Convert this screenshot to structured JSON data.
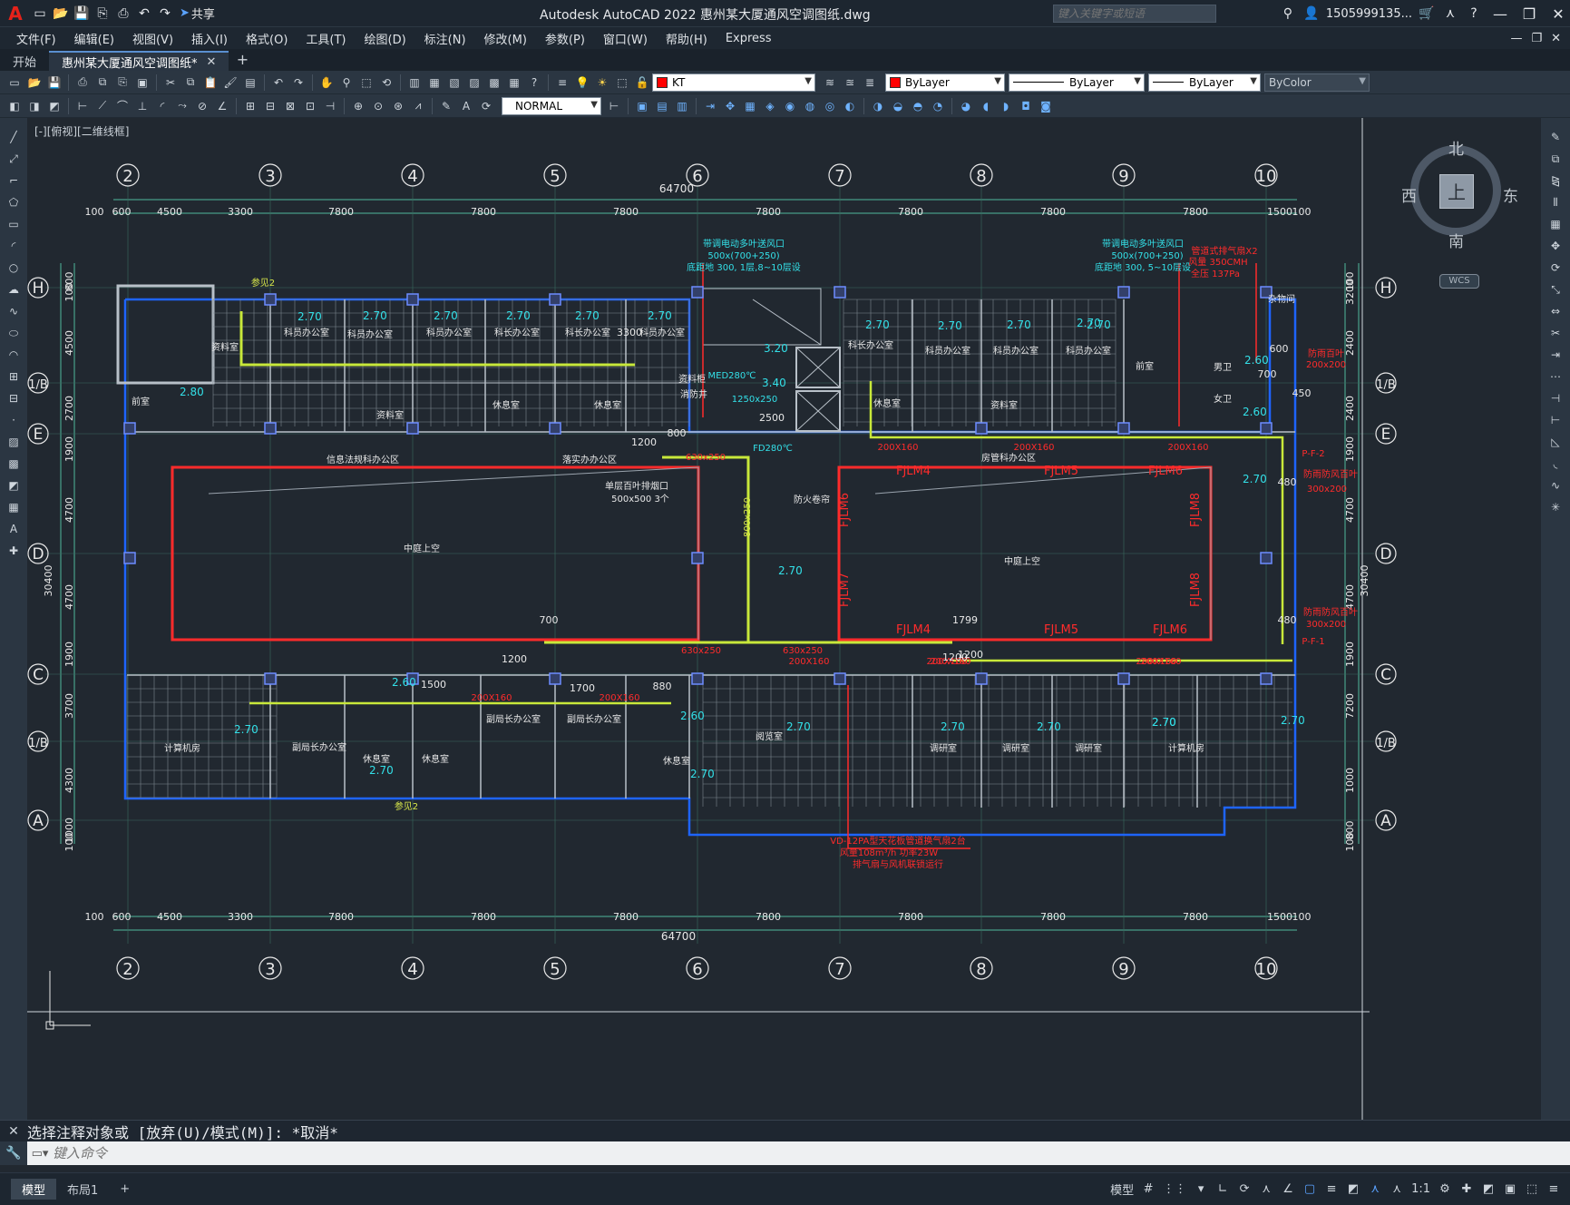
{
  "app": {
    "title": "Autodesk AutoCAD 2022    惠州某大厦通风空调图纸.dwg",
    "share_label": "共享",
    "search_placeholder": "键入关键字或短语",
    "user": "1505999135...",
    "brand_color": "#e5221a"
  },
  "menubar": [
    "文件(F)",
    "编辑(E)",
    "视图(V)",
    "插入(I)",
    "格式(O)",
    "工具(T)",
    "绘图(D)",
    "标注(N)",
    "修改(M)",
    "参数(P)",
    "窗口(W)",
    "帮助(H)",
    "Express"
  ],
  "tabs": [
    {
      "label": "开始",
      "active": false
    },
    {
      "label": "惠州某大厦通风空调图纸*",
      "active": true
    }
  ],
  "toolbar": {
    "layer": "KT",
    "color": "ByLayer",
    "linetype": "ByLayer",
    "lineweight": "ByLayer",
    "plotstyle": "ByColor",
    "dimstyle": "NORMAL",
    "layer_color": "#ff0000"
  },
  "viewport": {
    "label": "[-][俯视][二维线框]"
  },
  "viewcube": {
    "face": "上",
    "north": "北",
    "south": "南",
    "east": "东",
    "west": "西",
    "wcs": "WCS"
  },
  "drawing": {
    "grid_top": [
      "2",
      "3",
      "4",
      "5",
      "6",
      "7",
      "8",
      "9",
      "10"
    ],
    "grid_left": [
      "H",
      "1/B",
      "E",
      "D",
      "C",
      "1/B",
      "A"
    ],
    "total_width": "64700",
    "dims_top": [
      "100",
      "600",
      "4500",
      "3300",
      "7800",
      "7800",
      "7800",
      "7800",
      "7800",
      "7800",
      "7800",
      "1500",
      "100"
    ],
    "dims_left": [
      "800",
      "100",
      "4500",
      "2700",
      "1900",
      "4700",
      "4700",
      "1900",
      "3700",
      "4300",
      "1000",
      "100"
    ],
    "dims_left_total": "30400",
    "dims_right": [
      "100",
      "3200",
      "2400",
      "2400",
      "1900",
      "4700",
      "4700",
      "1900",
      "7200",
      "1000",
      "800",
      "100"
    ],
    "dims_right_total": "30400",
    "rooms": {
      "r1": "资料室",
      "r2": "科员办公室",
      "r3": "科员办公室",
      "r4": "科员办公室",
      "r5": "科长办公室",
      "r6": "科长办公室",
      "r7": "科员办公室",
      "r8": "资料室",
      "r9": "休息室",
      "r10": "休息室",
      "r11": "前室",
      "r12": "资料柜",
      "r13": "消防井",
      "r14": "科长办公室",
      "r15": "科员办公室",
      "r16": "科员办公室",
      "r17": "科员办公室",
      "r18": "休息室",
      "r19": "资料室",
      "r20": "前室",
      "r21": "男卫",
      "r22": "女卫",
      "r23": "杂物间",
      "r24": "信息法规科办公区",
      "r25": "落实办办公区",
      "r26": "房管科办公区",
      "r27": "中庭上空",
      "r28": "中庭上空",
      "r29": "计算机房",
      "r30": "副局长办公室",
      "r31": "休息室",
      "r32": "休息室",
      "r33": "副局长办公室",
      "r34": "副局长办公室",
      "r35": "休息室",
      "r36": "阅览室",
      "r37": "调研室",
      "r38": "调研室",
      "r39": "调研室",
      "r40": "计算机房",
      "r41": "防火卷帘"
    },
    "notes": {
      "n1": "带调电动多叶送风口",
      "n2": "500x(700+250)",
      "n3": "底距地 300, 1层,8~10层设",
      "n4": "带调电动多叶送风口",
      "n5": "500x(700+250)",
      "n6": "底距地 300, 5~10层设",
      "n7": "管道式排气扇X2",
      "n8": "风量 350CMH",
      "n9": "全压 137Pa",
      "n10": "单层百叶排烟口",
      "n11": "500x500 3个",
      "n12": "VD-12PA型天花板管道换气扇2台",
      "n13": "风量108m³/h 功率23W",
      "n14": "排气扇与风机联锁运行",
      "n15": "防雨百叶",
      "n16": "200x200",
      "n17": "防雨防风百叶",
      "n18": "300x200",
      "n19": "防雨防风百叶",
      "n20": "300x200",
      "n21": "MED280℃",
      "n22": "1250x250",
      "n23": "FD280℃",
      "n24": "P-F-2",
      "n25": "P-F-1",
      "n26": "参见2",
      "n27": "参见2"
    },
    "elev": {
      "e1": "2.70",
      "e2": "2.70",
      "e3": "2.70",
      "e4": "2.70",
      "e5": "2.70",
      "e6": "2.70",
      "e7": "2.80",
      "e8": "3.20",
      "e9": "3.40",
      "e10": "2.70",
      "e11": "2.70",
      "e12": "2.70",
      "e13": "2.70",
      "e14": "2.60",
      "e15": "2.60",
      "e16": "2.70",
      "e17": "2.70",
      "e18": "2.60",
      "e19": "2.60",
      "e20": "2.70",
      "e21": "2.70",
      "e22": "2.70",
      "e23": "2.70",
      "e24": "2.70",
      "e25": "2.70",
      "e26": "2.70",
      "e27": "2.70",
      "e28": "2.70",
      "e29": "2.70"
    },
    "ducts": {
      "d1": "630x250",
      "d2": "630x250",
      "d3": "630x250",
      "d4": "800x250",
      "d5": "200X160",
      "d6": "200X160",
      "d7": "200X160",
      "d8": "200X160",
      "d9": "200X160",
      "d10": "200X160",
      "d11": "200X160",
      "d12": "200X160",
      "d13": "200X160",
      "d14": "200X160"
    },
    "dimsmall": {
      "s1": "800",
      "s2": "1200",
      "s3": "2500",
      "s4": "700",
      "s5": "1200",
      "s6": "1799",
      "s7": "1200",
      "s8": "1500",
      "s9": "1700",
      "s10": "880",
      "s11": "700",
      "s12": "600",
      "s13": "450",
      "s14": "480",
      "s15": "480",
      "s16": "1200",
      "s17": "3300"
    },
    "fjlm": {
      "f1": "FJLM4",
      "f2": "FJLM5",
      "f3": "FJLM6",
      "f4": "FJLM6",
      "f5": "FJLM7",
      "f6": "FJLM8",
      "f7": "FJLM8",
      "f8": "FJLM4",
      "f9": "FJLM5",
      "f10": "FJLM6"
    }
  },
  "command": {
    "history": "选择注释对象或 [放弃(U)/模式(M)]: *取消*",
    "placeholder": "键入命令"
  },
  "layouts": [
    "模型",
    "布局1"
  ],
  "status": {
    "model": "模型",
    "scale": "1:1"
  }
}
